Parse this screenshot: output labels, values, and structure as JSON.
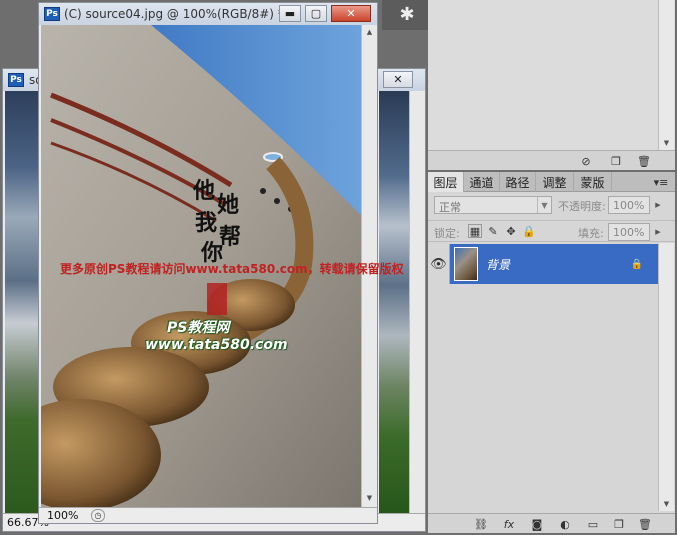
{
  "doc_main": {
    "title": "(C) source04.jpg @ 100%(RGB/8#) *",
    "zoom": "100%",
    "ps_badge": "Ps",
    "canvas_text": {
      "calligraphy": [
        "他",
        "她",
        "我",
        "帮",
        "你"
      ],
      "watermark_line": "更多原创PS教程请访问www.tata580.com，转载请保留版权",
      "logo_line": "PS教程网",
      "url_line": "www.tata580.com"
    }
  },
  "doc_back": {
    "title_fragment": "sou",
    "ps_badge": "Ps",
    "zoom": "66.67%"
  },
  "layers_panel": {
    "tabs": [
      "图层",
      "通道",
      "路径",
      "调整",
      "蒙版"
    ],
    "blend_mode": "正常",
    "opacity_label": "不透明度:",
    "opacity_value": "100%",
    "lock_label": "锁定:",
    "fill_label": "填充:",
    "fill_value": "100%",
    "layers": [
      {
        "name": "背景",
        "visible": true,
        "locked": true,
        "selected": true
      }
    ]
  },
  "colors": {
    "accent_selected": "#3a6bc4",
    "panel_bg": "#d6d6d6",
    "workspace_bg": "#6e6e6e"
  },
  "icons": {
    "settings": "pinwheel-icon",
    "layer_visibility": "eye-icon",
    "layer_lock": "lock-icon",
    "footer": [
      "link-icon",
      "fx-icon",
      "mask-icon",
      "adjustment-icon",
      "folder-icon",
      "new-layer-icon",
      "trash-icon"
    ]
  }
}
